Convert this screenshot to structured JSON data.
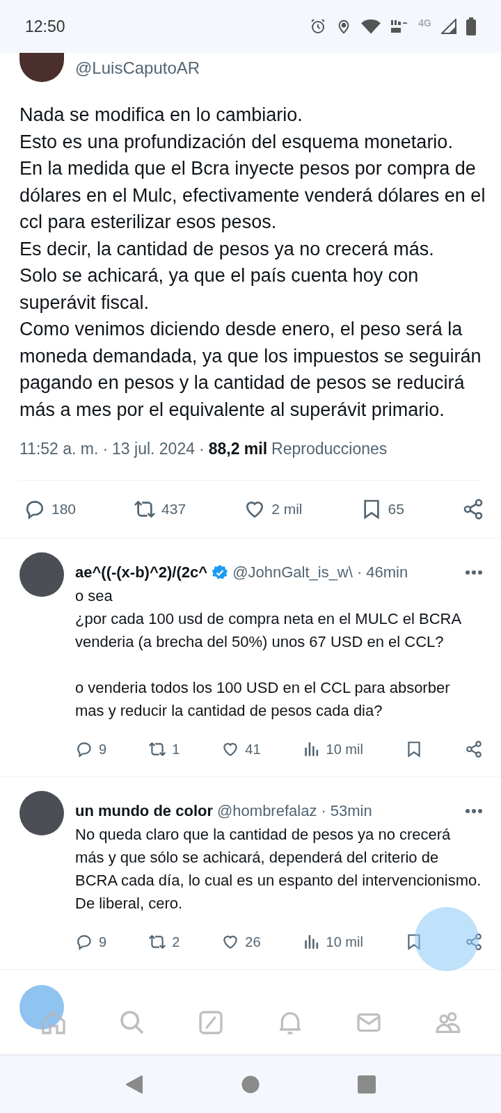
{
  "status_bar": {
    "time": "12:50",
    "network": "4G"
  },
  "main_tweet": {
    "handle": "@LuisCaputoAR",
    "text": "Nada se modifica en lo cambiario.\nEsto es una profundización del esquema monetario.\nEn la medida que el Bcra inyecte pesos por compra de dólares en el Mulc, efectivamente venderá dólares en el ccl para esterilizar esos pesos.\nEs decir, la cantidad de pesos ya no crecerá más.\nSolo se achicará, ya que el país cuenta hoy con superávit fiscal.\nComo venimos diciendo desde enero, el peso será la moneda demandada, ya que los impuestos se seguirán pagando en pesos y la cantidad de pesos se reducirá más a mes por el equivalente al superávit primario.",
    "time": "11:52 a. m.",
    "separators": [
      "·",
      "·"
    ],
    "date": "13 jul. 2024",
    "views": "88,2 mil",
    "views_label": "Reproducciones",
    "actions": [
      {
        "kind": "reply",
        "count": "180"
      },
      {
        "kind": "repost",
        "count": "437"
      },
      {
        "kind": "like",
        "count": "2 mil"
      },
      {
        "kind": "bookmark",
        "count": "65"
      },
      {
        "kind": "share"
      }
    ]
  },
  "replies": [
    {
      "name": "ae^((-(x-b)^2)/(2c^",
      "verified": true,
      "handle": "@JohnGalt_is_w\\",
      "separator": "·",
      "time": "46min",
      "text": "o sea\n¿por cada 100 usd de compra neta en el MULC el BCRA venderia (a brecha del 50%) unos 67 USD en el CCL?\n\no venderia todos los 100 USD en el CCL para absorber mas y reducir la cantidad de pesos cada dia?",
      "actions": [
        {
          "kind": "reply",
          "count": "9"
        },
        {
          "kind": "repost",
          "count": "1"
        },
        {
          "kind": "like",
          "count": "41"
        },
        {
          "kind": "views",
          "count": "10 mil"
        },
        {
          "kind": "bookmark"
        },
        {
          "kind": "share"
        }
      ]
    },
    {
      "name": "un mundo de color",
      "verified": false,
      "handle": "@hombrefalaz",
      "separator": "·",
      "time": "53min",
      "text": "No queda claro que la cantidad de pesos ya no crecerá más y que sólo se achicará, dependerá del criterio de BCRA cada día, lo cual es un espanto del intervencionismo.  De liberal, cero.",
      "actions": [
        {
          "kind": "reply",
          "count": "9"
        },
        {
          "kind": "repost",
          "count": "2"
        },
        {
          "kind": "like",
          "count": "26"
        },
        {
          "kind": "views",
          "count": "10 mil"
        },
        {
          "kind": "bookmark"
        },
        {
          "kind": "share"
        }
      ]
    }
  ],
  "bottom_nav": [
    {
      "kind": "home"
    },
    {
      "kind": "search"
    },
    {
      "kind": "grok"
    },
    {
      "kind": "notifications"
    },
    {
      "kind": "messages"
    },
    {
      "kind": "communities"
    }
  ]
}
